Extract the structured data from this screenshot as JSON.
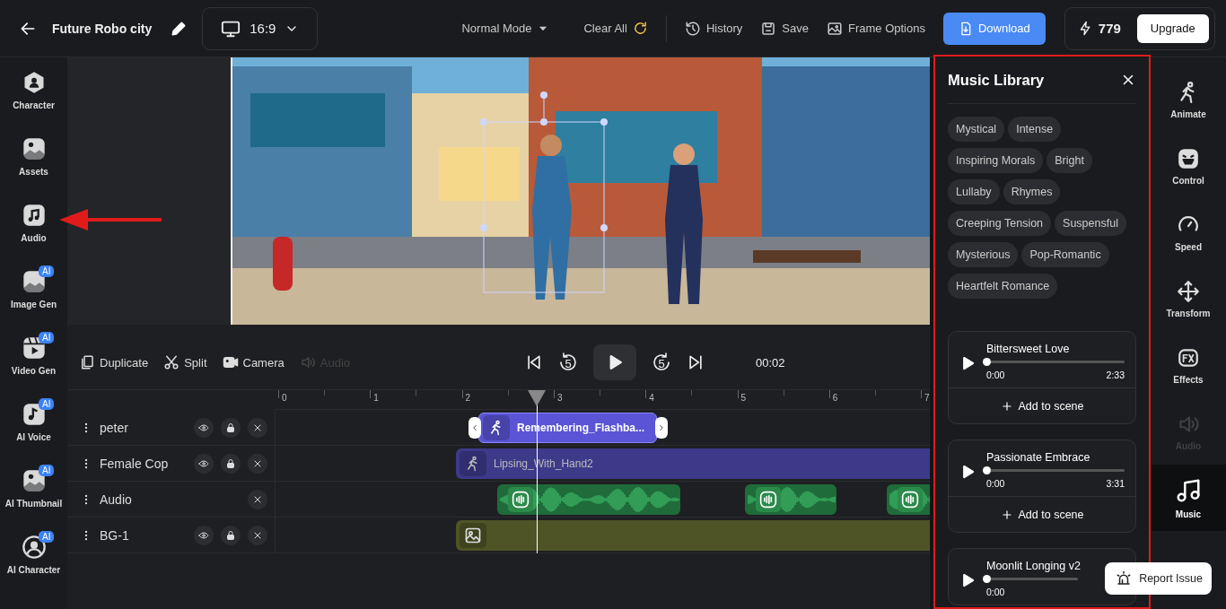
{
  "header": {
    "title": "Future Robo city",
    "aspect": "16:9",
    "mode": "Normal Mode",
    "actions": [
      {
        "kind": "clear",
        "label": "Clear All"
      },
      {
        "kind": "history",
        "label": "History"
      },
      {
        "kind": "save",
        "label": "Save"
      },
      {
        "kind": "frame",
        "label": "Frame Options"
      }
    ],
    "download": "Download",
    "credits": "779",
    "upgrade": "Upgrade"
  },
  "left_sidebar": [
    {
      "kind": "character",
      "label": "Character"
    },
    {
      "kind": "assets",
      "label": "Assets"
    },
    {
      "kind": "audio",
      "label": "Audio"
    },
    {
      "kind": "image_gen",
      "label": "Image Gen",
      "badge": "AI"
    },
    {
      "kind": "video_gen",
      "label": "Video Gen",
      "badge": "AI"
    },
    {
      "kind": "voice",
      "label": "AI Voice",
      "badge": "AI"
    },
    {
      "kind": "thumbnail",
      "label": "AI Thumbnail",
      "badge": "AI"
    },
    {
      "kind": "ai_character",
      "label": "AI Character",
      "badge": "AI"
    }
  ],
  "timeline": {
    "tools": [
      {
        "kind": "duplicate",
        "label": "Duplicate",
        "disabled": false
      },
      {
        "kind": "split",
        "label": "Split",
        "disabled": false
      },
      {
        "kind": "camera",
        "label": "Camera",
        "disabled": false
      },
      {
        "kind": "audio",
        "label": "Audio",
        "disabled": true
      }
    ],
    "rewind": "5",
    "forward": "5",
    "time": "00:02",
    "ruler": [
      "0",
      "1",
      "2",
      "3",
      "4",
      "5",
      "6",
      "7"
    ],
    "tracks": [
      {
        "name": "peter",
        "kind": "layer",
        "clips": [
          {
            "kind": "animation",
            "label": "Remembering_Flashba...",
            "selected": true
          }
        ]
      },
      {
        "name": "Female Cop",
        "kind": "layer",
        "clips": [
          {
            "kind": "animation",
            "label": "Lipsing_With_Hand2",
            "selected": false
          }
        ]
      },
      {
        "name": "Audio",
        "kind": "audio",
        "clips": [
          {
            "kind": "audio",
            "selected": false
          },
          {
            "kind": "audio",
            "selected": false
          },
          {
            "kind": "audio",
            "selected": false
          }
        ]
      },
      {
        "name": "BG-1",
        "kind": "layer",
        "clips": [
          {
            "kind": "background",
            "selected": false
          }
        ]
      }
    ]
  },
  "music": {
    "title": "Music Library",
    "tags": [
      "Mystical",
      "Intense",
      "Inspiring Morals",
      "Bright",
      "Lullaby",
      "Rhymes",
      "Creeping Tension",
      "Suspensful",
      "Mysterious",
      "Pop-Romantic",
      "Heartfelt Romance"
    ],
    "tracks": [
      {
        "title": "Bittersweet Love",
        "position": "0:00",
        "duration": "2:33",
        "level": 0,
        "action": "Add to scene"
      },
      {
        "title": "Passionate Embrace",
        "position": "0:00",
        "duration": "3:31",
        "level": 0,
        "action": "Add to scene"
      },
      {
        "title": "Moonlit Longing v2",
        "position": "0:00",
        "level": 0
      }
    ]
  },
  "right_sidebar": [
    {
      "kind": "animate",
      "label": "Animate",
      "selected": false,
      "disabled": false
    },
    {
      "kind": "control",
      "label": "Control",
      "selected": false,
      "disabled": false
    },
    {
      "kind": "speed",
      "label": "Speed",
      "selected": false,
      "disabled": false
    },
    {
      "kind": "transform",
      "label": "Transform",
      "selected": false,
      "disabled": false
    },
    {
      "kind": "effects",
      "label": "Effects",
      "selected": false,
      "disabled": false
    },
    {
      "kind": "audio",
      "label": "Audio",
      "selected": false,
      "disabled": true
    },
    {
      "kind": "music",
      "label": "Music",
      "selected": true,
      "disabled": false
    }
  ],
  "report": "Report Issue"
}
